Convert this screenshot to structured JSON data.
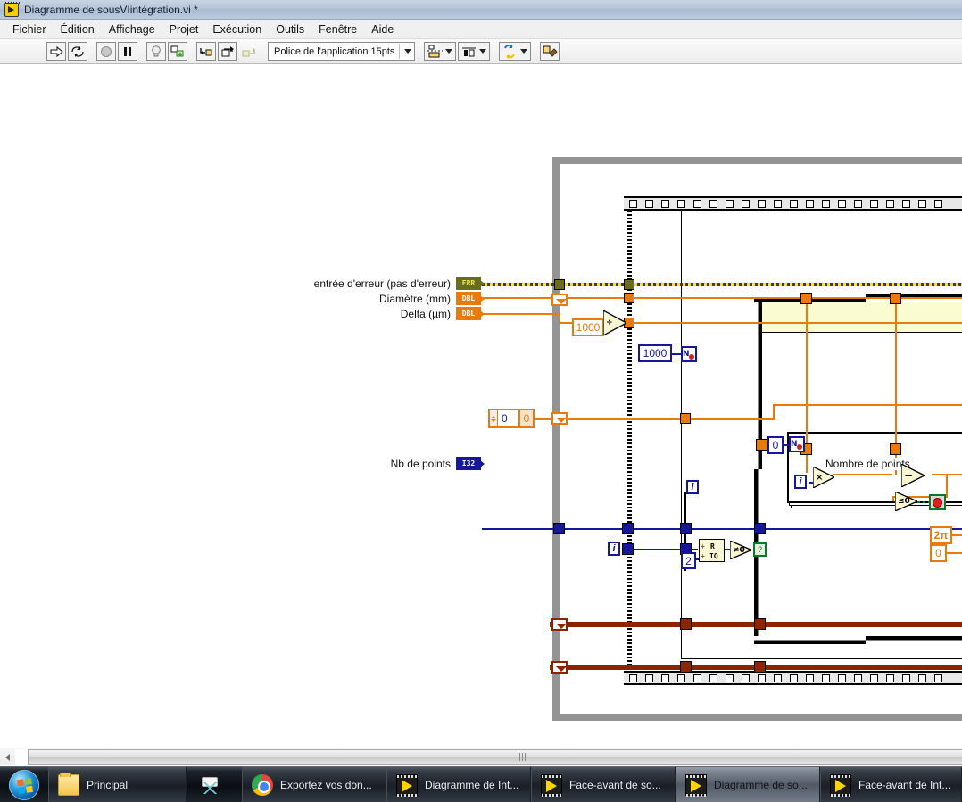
{
  "window": {
    "title": "Diagramme de sousVIintégration.vi *",
    "icon": "labview-vi-icon"
  },
  "menu": {
    "items": [
      "Fichier",
      "Édition",
      "Affichage",
      "Projet",
      "Exécution",
      "Outils",
      "Fenêtre",
      "Aide"
    ]
  },
  "toolbar": {
    "run_icon": "run-arrow-icon",
    "run_continuous_icon": "run-continuously-icon",
    "abort_icon": "abort-execution-icon",
    "pause_icon": "pause-icon",
    "highlight_icon": "highlight-execution-lightbulb-icon",
    "retain_values_icon": "retain-wire-values-icon",
    "step_into_icon": "step-into-icon",
    "step_over_icon": "step-over-icon",
    "step_out_icon": "step-out-icon",
    "font_label": "Police de l'application 15pts",
    "align_icon": "align-objects-icon",
    "distribute_icon": "distribute-objects-icon",
    "reorder_icon": "reorder-icon",
    "cleanup_icon": "clean-up-diagram-icon"
  },
  "diagram": {
    "terminals": [
      {
        "label": "entrée d'erreur (pas d'erreur)",
        "type": "error-cluster",
        "badge": "ERR"
      },
      {
        "label": "Diamètre (mm)",
        "type": "double",
        "badge": "DBL"
      },
      {
        "label": "Delta (µm)",
        "type": "double",
        "badge": "DBL"
      },
      {
        "label": "Nb de points",
        "type": "int32",
        "badge": "I32"
      }
    ],
    "wire_labels": [
      {
        "text": "Nombre de points"
      }
    ],
    "constants": [
      {
        "value": "1000",
        "color": "#E87B0C",
        "name": "thousand-constant-divider"
      },
      {
        "value": "1000",
        "color": "#16179A",
        "name": "thousand-constant-loop-count"
      },
      {
        "value": "0",
        "color": "#E87B0C",
        "name": "zero-constant-orange"
      },
      {
        "value": "0",
        "color": "#16179A",
        "name": "zero-constant-blue-loop"
      },
      {
        "value": "2",
        "color": "#16179A",
        "name": "two-constant-quotient"
      },
      {
        "value": "2π",
        "color": "#E87B0C",
        "name": "two-pi-constant"
      },
      {
        "value": "0",
        "color": "#E87B0C",
        "name": "zero-constant-right"
      }
    ],
    "numeric_control": {
      "value": "0",
      "name": "numeric-spinner-zero"
    },
    "functions": [
      {
        "glyph": "÷",
        "name": "divide-function"
      },
      {
        "glyph": "×",
        "name": "multiply-function"
      },
      {
        "glyph": "−",
        "name": "subtract-function"
      },
      {
        "glyph": "≤0",
        "name": "less-equal-zero-function"
      },
      {
        "glyph": "≠0",
        "name": "not-equal-zero-function"
      },
      {
        "glyph": "R IQ",
        "name": "quotient-remainder-function"
      }
    ],
    "iterator_labels": [
      "i",
      "i",
      "i"
    ],
    "loop_count_labels": [
      "N",
      "N"
    ],
    "case_selector": "?",
    "stop_button": "stop-control"
  },
  "scrollbar": {
    "left_arrow": "scroll-left-arrow",
    "grip": "scroll-thumb-grip"
  },
  "taskbar": {
    "start": "start-orb",
    "items": [
      {
        "label": "Principal",
        "icon": "folder-icon",
        "active": false
      },
      {
        "label": "",
        "icon": "snipping-tool-icon",
        "active": false
      },
      {
        "label": "Exportez vos don...",
        "icon": "chrome-icon",
        "active": false
      },
      {
        "label": "Diagramme de Int...",
        "icon": "labview-icon",
        "active": false
      },
      {
        "label": "Face-avant de so...",
        "icon": "labview-icon",
        "active": false
      },
      {
        "label": "Diagramme de so...",
        "icon": "labview-icon",
        "active": true
      },
      {
        "label": "Face-avant de Int...",
        "icon": "labview-icon",
        "active": false
      }
    ]
  }
}
